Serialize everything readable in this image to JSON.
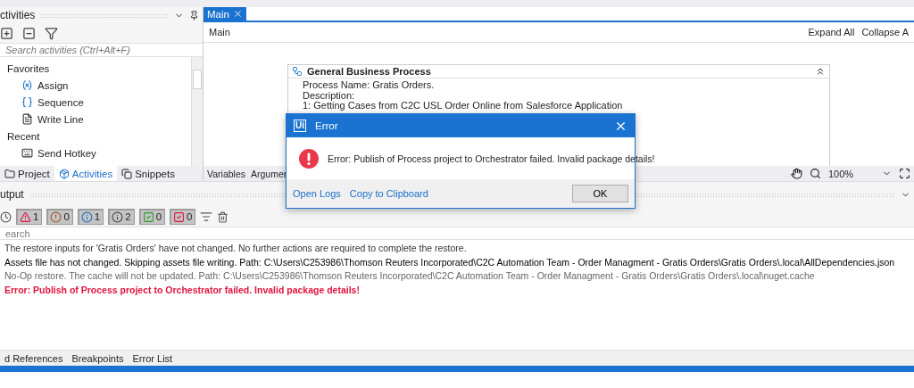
{
  "activities_panel": {
    "title": "ctivities",
    "search": {
      "placeholder": "Search activities (Ctrl+Alt+F)"
    },
    "groups": [
      {
        "label": "Favorites",
        "children": [
          {
            "label": "Assign",
            "kind": "assign"
          },
          {
            "label": "Sequence",
            "kind": "sequence"
          },
          {
            "label": "Write Line",
            "kind": "writeline"
          }
        ]
      },
      {
        "label": "Recent",
        "children": [
          {
            "label": "Send Hotkey",
            "kind": "hotkey"
          }
        ]
      }
    ],
    "tabs": [
      {
        "label": "Project",
        "selected": false
      },
      {
        "label": "Activities",
        "selected": true
      },
      {
        "label": "Snippets",
        "selected": false
      }
    ]
  },
  "editor": {
    "tabs": [
      {
        "label": "Main",
        "selected": true
      }
    ],
    "breadcrumb": "Main",
    "actions": [
      "Expand All",
      "Collapse A"
    ],
    "card": {
      "title": "General Business Process",
      "lines": [
        "Process Name: Gratis Orders.",
        "Description:",
        "1: Getting Cases from C2C USL Order Online from Salesforce Application"
      ]
    },
    "bottom_tabs": [
      "Variables",
      "Argumer"
    ],
    "zoom": "100%"
  },
  "output_panel": {
    "title": "utput",
    "filters": [
      {
        "kind": "error",
        "count": "1"
      },
      {
        "kind": "warning",
        "count": "0"
      },
      {
        "kind": "info",
        "count": "1"
      },
      {
        "kind": "trace",
        "count": "2"
      },
      {
        "kind": "success",
        "count": "0"
      },
      {
        "kind": "failed",
        "count": "0"
      }
    ],
    "search": {
      "placeholder": "earch"
    },
    "lines": [
      {
        "kind": "info",
        "text": "The restore inputs for 'Gratis Orders' have not changed. No further actions are required to complete the restore."
      },
      {
        "kind": "bold",
        "text": "Assets file has not changed. Skipping assets file writing. Path: C:\\Users\\C253986\\Thomson Reuters Incorporated\\C2C Automation Team - Order Managment - Gratis Orders\\Gratis Orders\\.local\\AllDependencies.json"
      },
      {
        "kind": "trace",
        "text": "No-Op restore. The cache will not be updated. Path: C:\\Users\\C253986\\Thomson Reuters Incorporated\\C2C Automation Team - Order Managment - Gratis Orders\\Gratis Orders\\.local\\nuget.cache"
      },
      {
        "kind": "error",
        "text": "Error: Publish of Process project to Orchestrator failed. Invalid package details!"
      }
    ]
  },
  "bottom_tabs": [
    "d References",
    "Breakpoints",
    "Error List"
  ],
  "dialog": {
    "logo": "Ui",
    "title": "Error",
    "message": "Error: Publish of Process project to Orchestrator failed. Invalid package details!",
    "links": [
      "Open Logs",
      "Copy to Clipboard"
    ],
    "button": "OK"
  }
}
